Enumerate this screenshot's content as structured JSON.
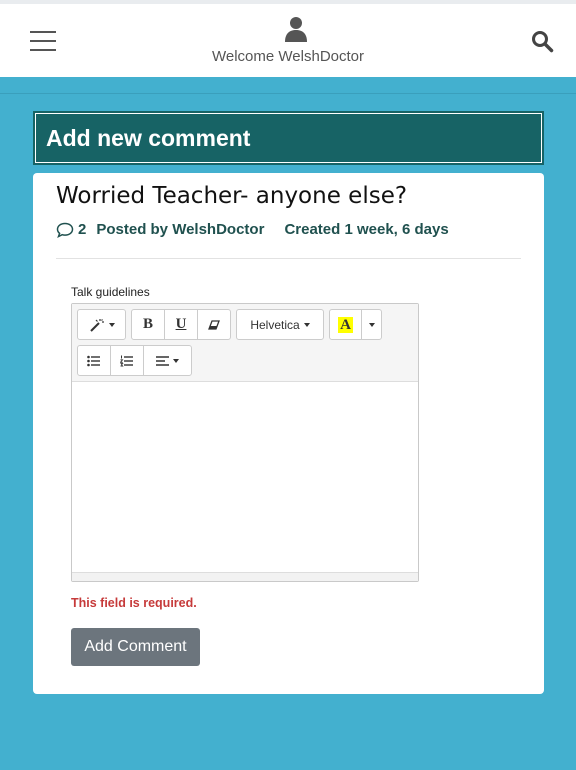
{
  "header": {
    "welcome_text": "Welcome WelshDoctor",
    "icons": {
      "menu": "hamburger-menu-icon",
      "user": "user-icon",
      "search": "search-icon"
    }
  },
  "section_title": "Add new comment",
  "post": {
    "title": "Worried Teacher- anyone else?",
    "comment_count": "2",
    "posted_by": "Posted by WelshDoctor",
    "created": "Created 1 week, 6 days"
  },
  "form": {
    "field_label": "Talk guidelines",
    "toolbar": {
      "font_name": "Helvetica",
      "bold_label": "B",
      "underline_label": "U",
      "color_label": "A",
      "icons": [
        "magic-wand-icon",
        "bold-icon",
        "underline-icon",
        "eraser-icon",
        "font-color-icon",
        "unordered-list-icon",
        "ordered-list-icon",
        "align-icon"
      ]
    },
    "error_text": "This field is required.",
    "submit_label": "Add Comment"
  },
  "colors": {
    "page_bg": "#43b0cf",
    "section_header_bg": "#176365",
    "meta_text": "#20514f",
    "error_text": "#c63a3a",
    "button_bg": "#6c757d",
    "highlight_yellow": "#ffff00"
  }
}
